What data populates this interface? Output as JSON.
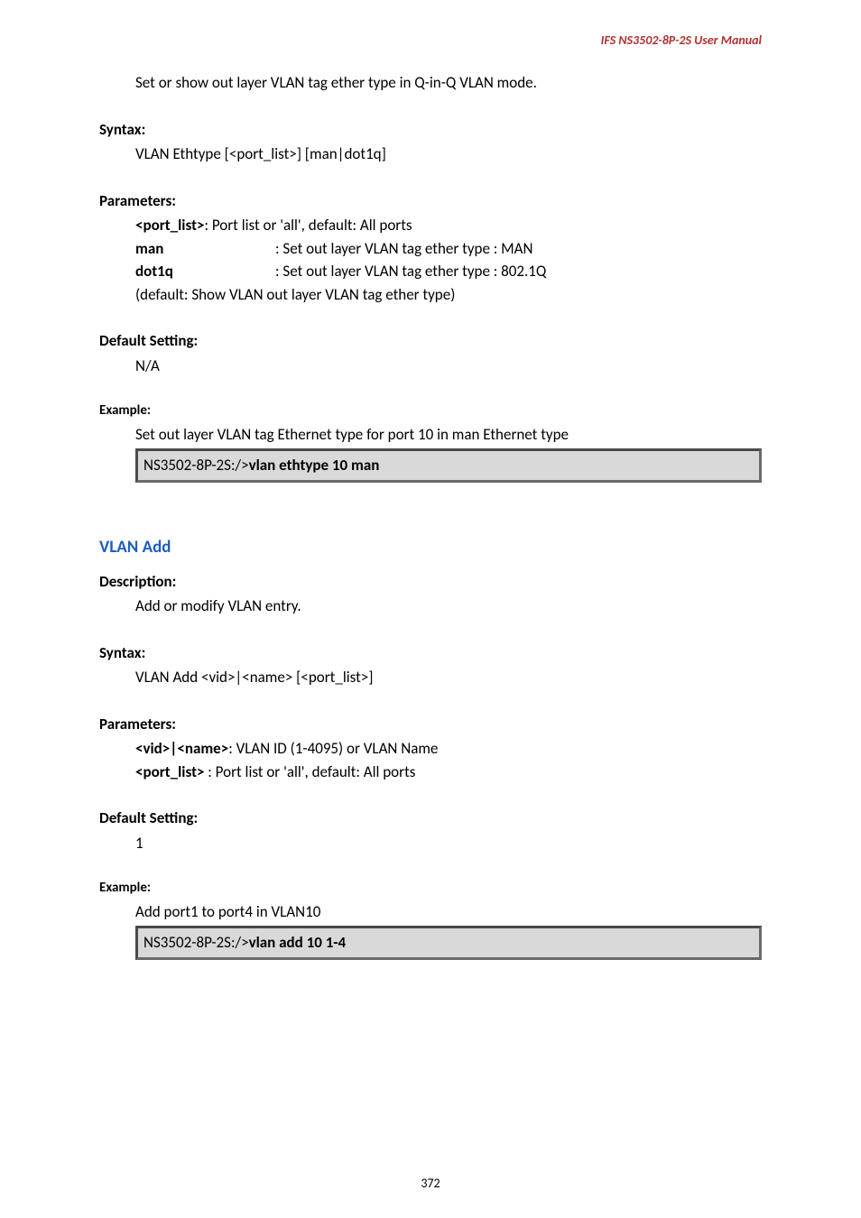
{
  "header": {
    "product": "IFS  NS3502-8P-2S  User  Manual"
  },
  "intro_line": "Set or show out layer VLAN tag ether type in Q-in-Q VLAN mode.",
  "sec_ethtype": {
    "syntax_label": "Syntax:",
    "syntax_value": "VLAN Ethtype [<port_list>] [man|dot1q]",
    "parameters_label": "Parameters:",
    "param_portlist_key": "<port_list>",
    "param_portlist_rest": ": Port list or 'all', default: All ports",
    "param_man_key": "man",
    "param_man_desc": ": Set out layer VLAN tag ether type : MAN",
    "param_dot1q_key": "dot1q",
    "param_dot1q_desc": ": Set out layer VLAN tag ether type : 802.1Q",
    "param_default_note": "(default: Show VLAN out layer VLAN tag ether type)",
    "default_label": "Default Setting:",
    "default_value": "N/A",
    "example_label": "Example:",
    "example_desc": "Set out layer VLAN tag Ethernet type for port 10 in man Ethernet type",
    "example_cmd_prefix": "NS3502-8P-2S:/>",
    "example_cmd_bold": "vlan ethtype 10 man"
  },
  "sec_vlan_add": {
    "heading": "VLAN Add",
    "description_label": "Description:",
    "description_value": "Add or modify VLAN entry.",
    "syntax_label": "Syntax:",
    "syntax_value": "VLAN Add <vid>|<name> [<port_list>]",
    "parameters_label": "Parameters:",
    "param_vidname_key": "<vid>|<name>",
    "param_vidname_rest": ": VLAN ID (1-4095) or VLAN Name",
    "param_portlist_key": "<port_list>",
    "param_portlist_rest": " : Port list or 'all', default: All ports",
    "default_label": "Default Setting:",
    "default_value": "1",
    "example_label": "Example:",
    "example_desc": "Add port1 to port4 in VLAN10",
    "example_cmd_prefix": "NS3502-8P-2S:/>",
    "example_cmd_bold": "vlan add 10 1-4"
  },
  "page_number": "372"
}
